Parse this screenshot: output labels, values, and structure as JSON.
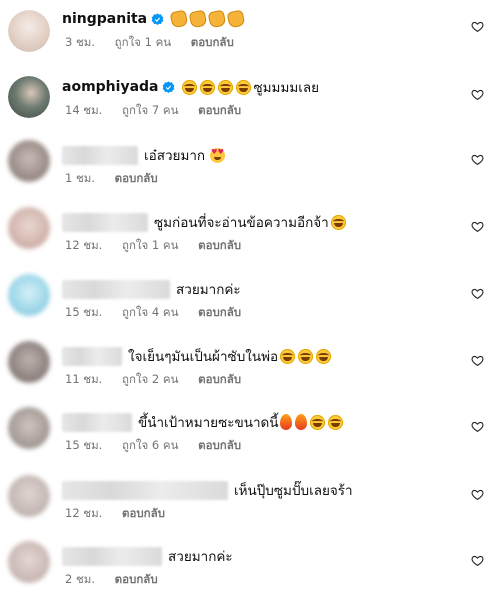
{
  "comments": [
    {
      "username": "ningpanita",
      "verified": true,
      "text": "",
      "emojis": [
        "clap",
        "clap",
        "clap",
        "clap"
      ],
      "time": "3 ชม.",
      "likes": "ถูกใจ 1 คน",
      "reply": "ตอบกลับ",
      "avatar_color": "#e9dcd2",
      "blurred": false
    },
    {
      "username": "aomphiyada",
      "verified": true,
      "text": "ซูมมมมเลย",
      "emojis_before": [
        "laugh",
        "laugh",
        "laugh",
        "laugh"
      ],
      "time": "14 ชม.",
      "likes": "ถูกใจ 7 คน",
      "reply": "ตอบกลับ",
      "avatar_color": "#4a5a52",
      "blurred": false
    },
    {
      "username": "",
      "text": "เอ๋สวยมาก",
      "emojis": [
        "heart-eyes"
      ],
      "time": "1 ชม.",
      "likes": "",
      "reply": "ตอบกลับ",
      "avatar_color": "#b8a9a4",
      "blurred": true
    },
    {
      "username": "",
      "text": "ซูมก่อนที่จะอ่านข้อความอีกจ้า",
      "emojis": [
        "laugh"
      ],
      "time": "12 ชม.",
      "likes": "ถูกใจ 1 คน",
      "reply": "ตอบกลับ",
      "avatar_color": "#d6b9b2",
      "blurred": true
    },
    {
      "username": "",
      "text": "สวยมากค่ะ",
      "emojis": [],
      "time": "15 ชม.",
      "likes": "ถูกใจ 4 คน",
      "reply": "ตอบกลับ",
      "avatar_color": "#8fd0e6",
      "blurred": true
    },
    {
      "username": "",
      "text": "ใจเย็นๆมันเป็นผ้าซับในพ่อ",
      "emojis": [
        "laugh",
        "laugh",
        "laugh"
      ],
      "time": "11 ชม.",
      "likes": "ถูกใจ 2 คน",
      "reply": "ตอบกลับ",
      "avatar_color": "#9b8f8c",
      "blurred": true
    },
    {
      "username": "",
      "text": "ขึ้นำเป้าหมายซะขนาดนี้",
      "emojis": [
        "fire",
        "fire",
        "laugh",
        "laugh"
      ],
      "time": "15 ชม.",
      "likes": "ถูกใจ 6 คน",
      "reply": "ตอบกลับ",
      "avatar_color": "#a89f9a",
      "blurred": true
    },
    {
      "username": "",
      "text": "เห็นปุ๊บซูมปั๊บเลยจร้า",
      "emojis": [],
      "time": "12 ชม.",
      "likes": "",
      "reply": "ตอบกลับ",
      "avatar_color": "#c9bdb8",
      "blurred": true
    },
    {
      "username": "",
      "text": "สวยมากค่ะ",
      "emojis": [],
      "time": "2 ชม.",
      "likes": "",
      "reply": "ตอบกลับ",
      "avatar_color": "#d4c3c0",
      "blurred": true
    }
  ]
}
